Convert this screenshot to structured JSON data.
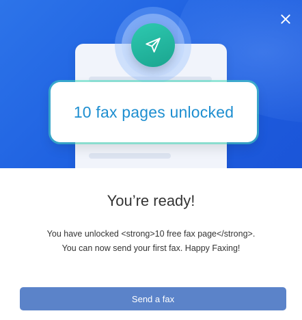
{
  "dialog": {
    "close_icon": "close-icon",
    "hero": {
      "badge_icon": "send-plane-icon",
      "unlock_text": "10 fax pages unlocked"
    },
    "title": "You’re ready!",
    "message_line1": "You have unlocked <strong>10 free fax page</strong>.",
    "message_line2": "You can now send your first fax. Happy Faxing!",
    "primary_button_label": "Send a fax"
  },
  "colors": {
    "hero_blue": "#1d5fe0",
    "accent_teal": "#1aa58f",
    "unlock_text": "#1d8ed0",
    "button": "#5b83c9"
  }
}
